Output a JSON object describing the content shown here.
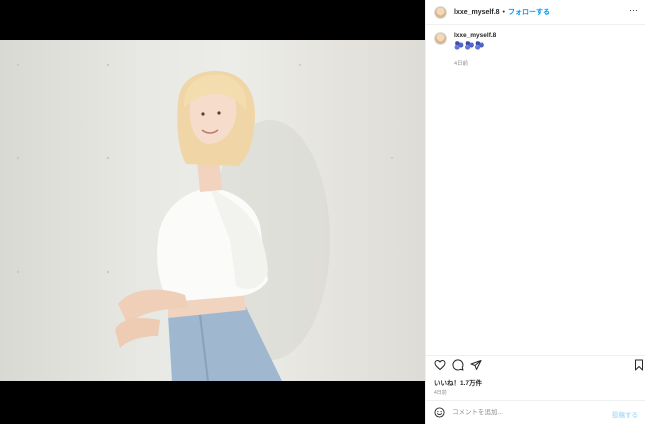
{
  "header": {
    "username": "lxxe_myself.8",
    "separator": "•",
    "follow_label": "フォローする",
    "more_label": "···"
  },
  "caption": {
    "username": "lxxe_myself.8",
    "text": "🫐🫐🫐",
    "time": "4日前"
  },
  "actions": {
    "icons": [
      "heart-icon",
      "comment-icon",
      "share-icon",
      "bookmark-icon"
    ],
    "likes": "いいね！1.7万件",
    "time": "4日前"
  },
  "comment": {
    "placeholder": "コメントを追加...",
    "post_label": "投稿する"
  },
  "colors": {
    "accent": "#0095f6",
    "post_disabled": "#b2dffc",
    "text": "#262626",
    "muted": "#8e8e8e"
  }
}
